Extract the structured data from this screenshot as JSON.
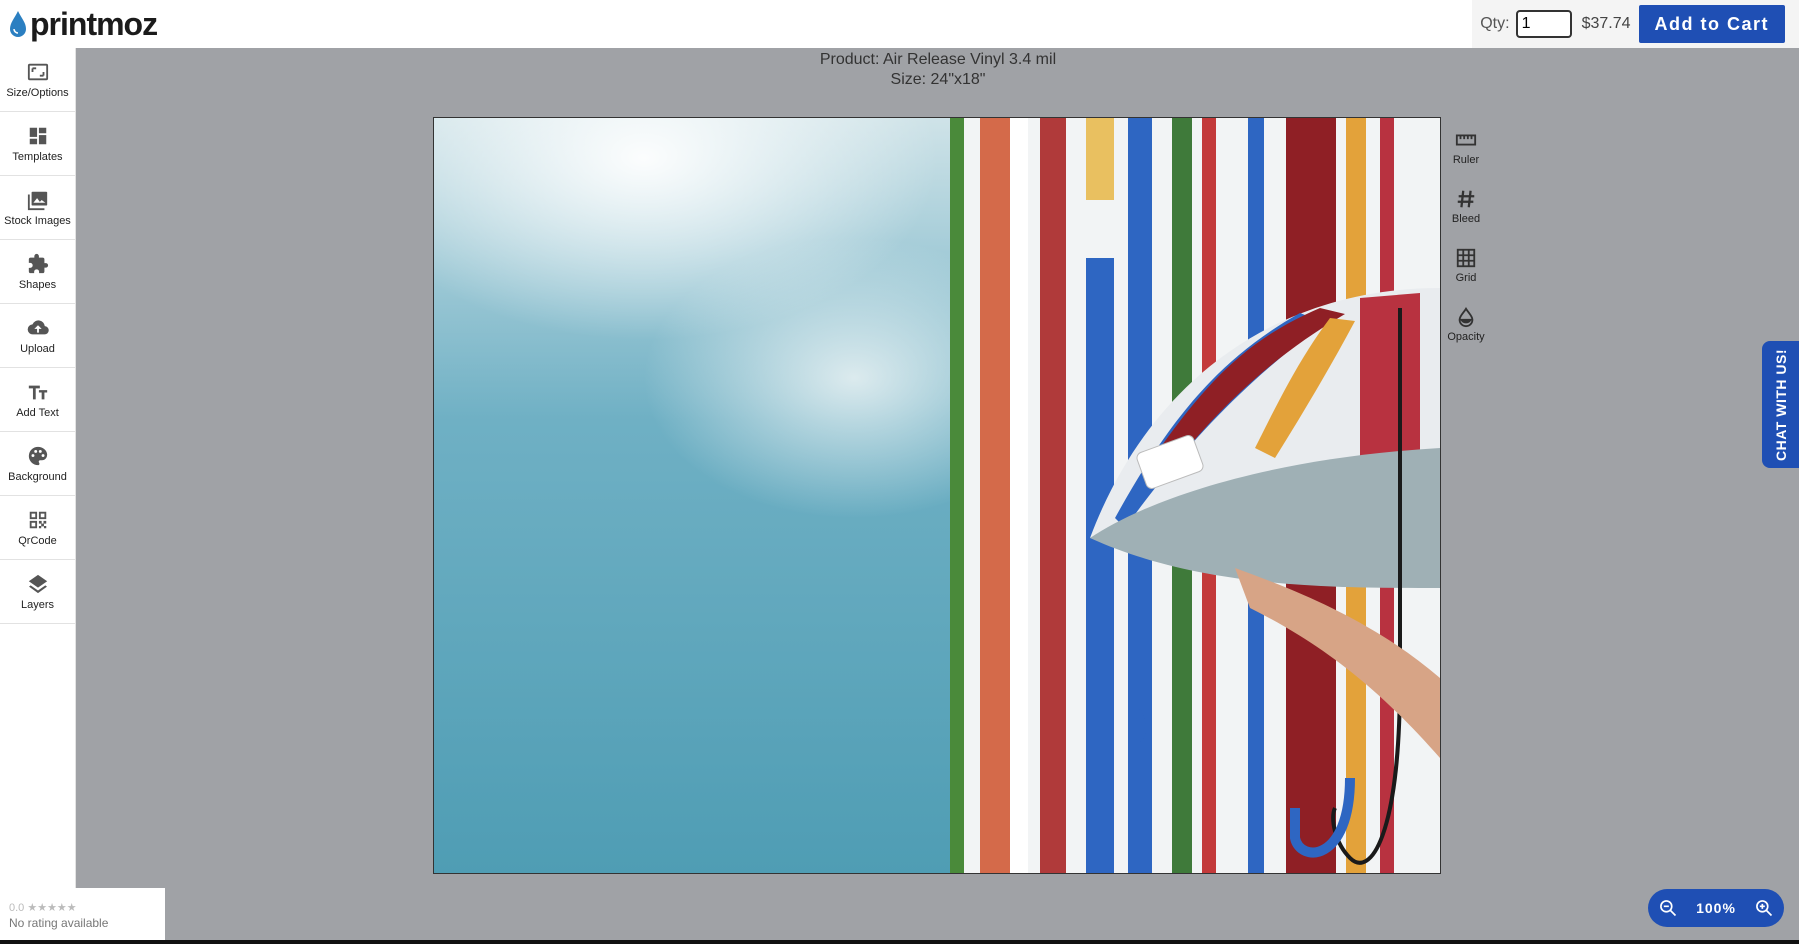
{
  "brand": {
    "logo_text": "printmoz",
    "accent_color": "#1f4fb4",
    "drop_color": "#2b7fc1"
  },
  "cart": {
    "qty_label": "Qty:",
    "qty_value": "1",
    "price": "$37.74",
    "add_label": "Add to Cart"
  },
  "sidebar": {
    "items": [
      {
        "label": "Size/Options",
        "icon": "resize-icon"
      },
      {
        "label": "Templates",
        "icon": "dashboard-icon"
      },
      {
        "label": "Stock Images",
        "icon": "image-icon"
      },
      {
        "label": "Shapes",
        "icon": "puzzle-icon"
      },
      {
        "label": "Upload",
        "icon": "cloud-upload-icon"
      },
      {
        "label": "Add Text",
        "icon": "text-icon"
      },
      {
        "label": "Background",
        "icon": "palette-icon"
      },
      {
        "label": "QrCode",
        "icon": "qr-code-icon"
      },
      {
        "label": "Layers",
        "icon": "layers-icon"
      }
    ]
  },
  "product": {
    "line1": "Product: Air Release Vinyl 3.4 mil",
    "line2": "Size: 24\"x18\""
  },
  "tools": {
    "items": [
      {
        "label": "Ruler",
        "icon": "ruler-icon"
      },
      {
        "label": "Bleed",
        "icon": "hash-icon"
      },
      {
        "label": "Grid",
        "icon": "grid-icon"
      },
      {
        "label": "Opacity",
        "icon": "opacity-icon"
      }
    ]
  },
  "chat": {
    "label": "CHAT WITH US!"
  },
  "rating": {
    "stars_text": "0.0 ★★★★★",
    "status": "No rating available"
  },
  "zoom": {
    "value": "100%"
  },
  "canvas": {
    "stripe_colors": [
      "#4a8a3a",
      "#d46a4a",
      "#ffffff",
      "#b03a3a",
      "#e9c060",
      "#2e66c2",
      "#3f7a3a",
      "#c33a3a",
      "#2e66c2",
      "#8f1f25",
      "#e3a23a",
      "#b83240"
    ]
  }
}
